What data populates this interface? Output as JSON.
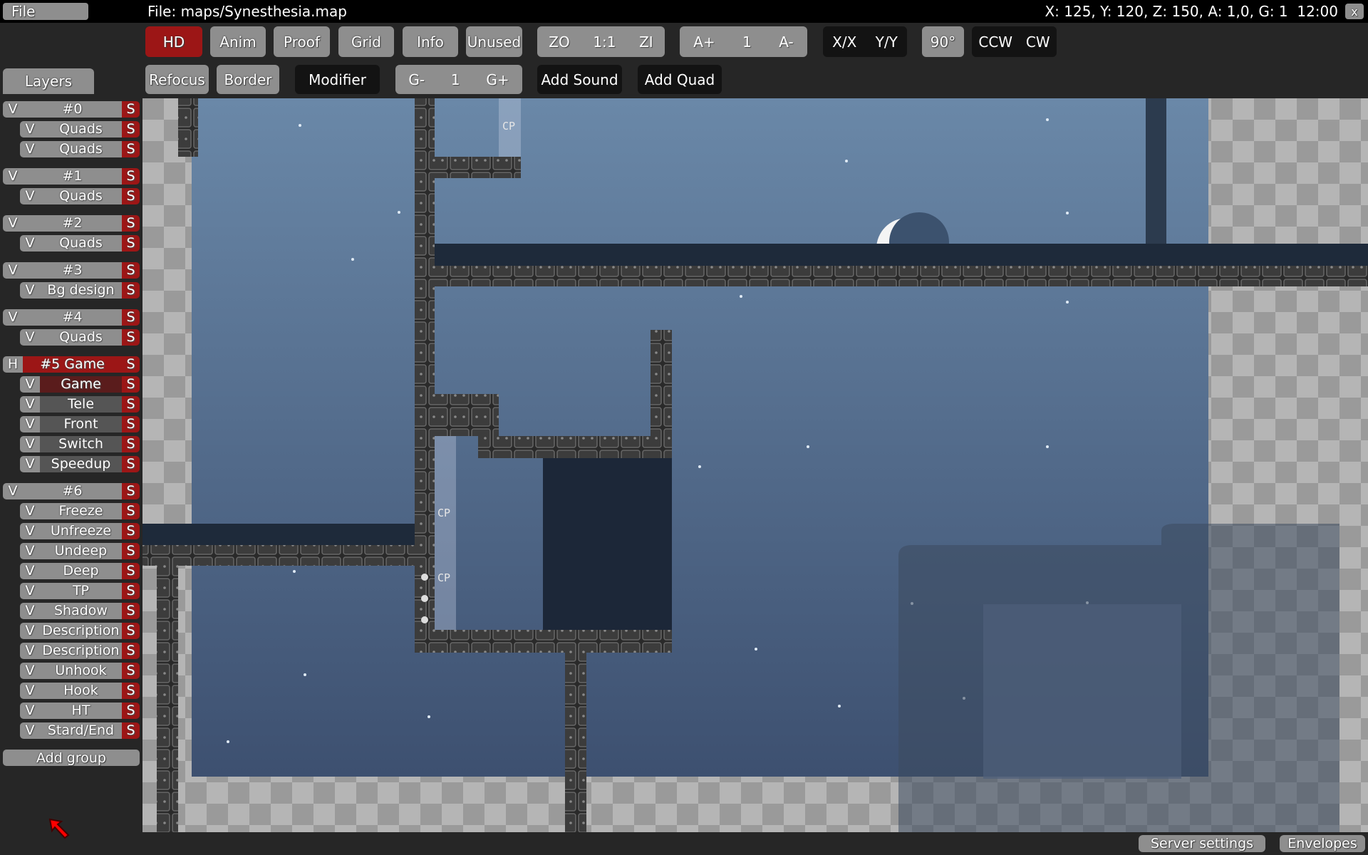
{
  "topbar": {
    "file_menu": "File",
    "file_title": "File: maps/Synesthesia.map",
    "status": "X: 125, Y: 120, Z: 150, A: 1,0, G: 1  12:00",
    "close_label": "x"
  },
  "toolbar": {
    "hd": "HD",
    "anim": "Anim",
    "proof": "Proof",
    "grid": "Grid",
    "info": "Info",
    "unused": "Unused",
    "zoom_out": "ZO",
    "zoom_reset": "1:1",
    "zoom_in": "ZI",
    "anim_faster": "A+",
    "anim_speed": "1",
    "anim_slower": "A-",
    "flip_x": "X/X",
    "flip_y": "Y/Y",
    "rotate_90": "90°",
    "ccw": "CCW",
    "cw": "CW",
    "refocus": "Refocus",
    "border": "Border",
    "modifier": "Modifier",
    "grid_minus": "G-",
    "grid_factor": "1",
    "grid_plus": "G+",
    "add_sound": "Add Sound",
    "add_quad": "Add Quad",
    "hd_active": true
  },
  "layers": {
    "tab": "Layers",
    "add_group": "Add group",
    "groups": [
      {
        "vis": "V",
        "name": "#0",
        "solo": "S",
        "layers": [
          "Quads",
          "Quads"
        ]
      },
      {
        "vis": "V",
        "name": "#1",
        "solo": "S",
        "layers": [
          "Quads"
        ]
      },
      {
        "vis": "V",
        "name": "#2",
        "solo": "S",
        "layers": [
          "Quads"
        ]
      },
      {
        "vis": "V",
        "name": "#3",
        "solo": "S",
        "layers": [
          "Bg design"
        ]
      },
      {
        "vis": "V",
        "name": "#4",
        "solo": "S",
        "layers": [
          "Quads"
        ]
      },
      {
        "vis": "H",
        "name": "#5 Game",
        "solo": "S",
        "active": true,
        "layers": [
          "Game",
          "Tele",
          "Front",
          "Switch",
          "Speedup"
        ]
      },
      {
        "vis": "V",
        "name": "#6",
        "solo": "S",
        "layers": [
          "Freeze",
          "Unfreeze",
          "Undeep",
          "Deep",
          "TP",
          "Shadow",
          "Description",
          "Description",
          "Unhook",
          "Hook",
          "HT",
          "Stard/End"
        ]
      }
    ],
    "layer_vis": "V",
    "layer_solo": "S"
  },
  "map": {
    "cp_label": "CP"
  },
  "bottombar": {
    "server_settings": "Server settings",
    "envelopes": "Envelopes"
  },
  "colors": {
    "accent_red": "#9c1616",
    "button_gray": "#8e8e8e",
    "sky_top": "#6a88a8",
    "sky_bottom": "#3d5070"
  }
}
